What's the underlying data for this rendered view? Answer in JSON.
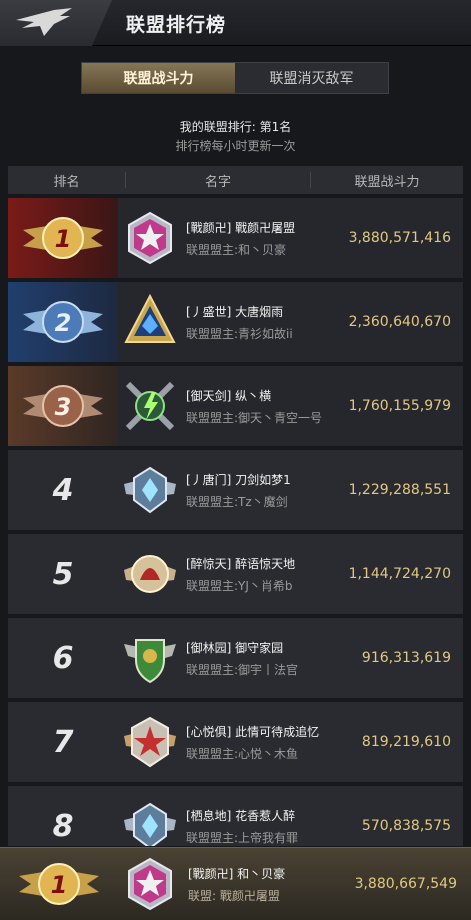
{
  "header": {
    "title": "联盟排行榜"
  },
  "tabs": [
    {
      "label": "联盟战斗力",
      "active": true
    },
    {
      "label": "联盟消灭敌军",
      "active": false
    }
  ],
  "my_rank": {
    "text": "我的联盟排行: 第1名",
    "update_note": "排行榜每小时更新一次"
  },
  "columns": {
    "rank": "排名",
    "name": "名字",
    "power": "联盟战斗力"
  },
  "rows": [
    {
      "rank": "1",
      "name": "[戰颜卍] 戰颜卍屠盟",
      "leader": "联盟盟主:和丶贝豪",
      "power": "3,880,571,416",
      "emblem": "pink-star-emblem"
    },
    {
      "rank": "2",
      "name": "[丿盛世] 大唐烟雨",
      "leader": "联盟盟主:青衫如故ii",
      "power": "2,360,640,670",
      "emblem": "blue-crystal-emblem"
    },
    {
      "rank": "3",
      "name": "[御天剑] 纵丶横",
      "leader": "联盟盟主:御天丶青空一号",
      "power": "1,760,155,979",
      "emblem": "green-lightning-emblem"
    },
    {
      "rank": "4",
      "name": "[丿唐门] 刀剑如梦1",
      "leader": "联盟盟主:Tz丶魔剑",
      "power": "1,229,288,551",
      "emblem": "silver-wing-emblem"
    },
    {
      "rank": "5",
      "name": "[醉惊天] 醉语惊天地",
      "leader": "联盟盟主:YJ丶肖希b",
      "power": "1,144,724,270",
      "emblem": "red-helmet-emblem"
    },
    {
      "rank": "6",
      "name": "[御林园] 御守家园",
      "leader": "联盟盟主:御宇丨法官",
      "power": "916,313,619",
      "emblem": "green-shield-emblem"
    },
    {
      "rank": "7",
      "name": "[心悦俱] 此情可待成追忆",
      "leader": "联盟盟主:心悦丶木鱼",
      "power": "819,219,610",
      "emblem": "red-star-emblem"
    },
    {
      "rank": "8",
      "name": "[栖息地] 花香惹人醉",
      "leader": "联盟盟主:上帝我有罪",
      "power": "570,838,575",
      "emblem": "silver-wing-emblem"
    }
  ],
  "mine": {
    "rank": "1",
    "name": "[戰颜卍] 和丶贝豪",
    "alliance": "联盟: 戰颜卍屠盟",
    "power": "3,880,667,549"
  }
}
